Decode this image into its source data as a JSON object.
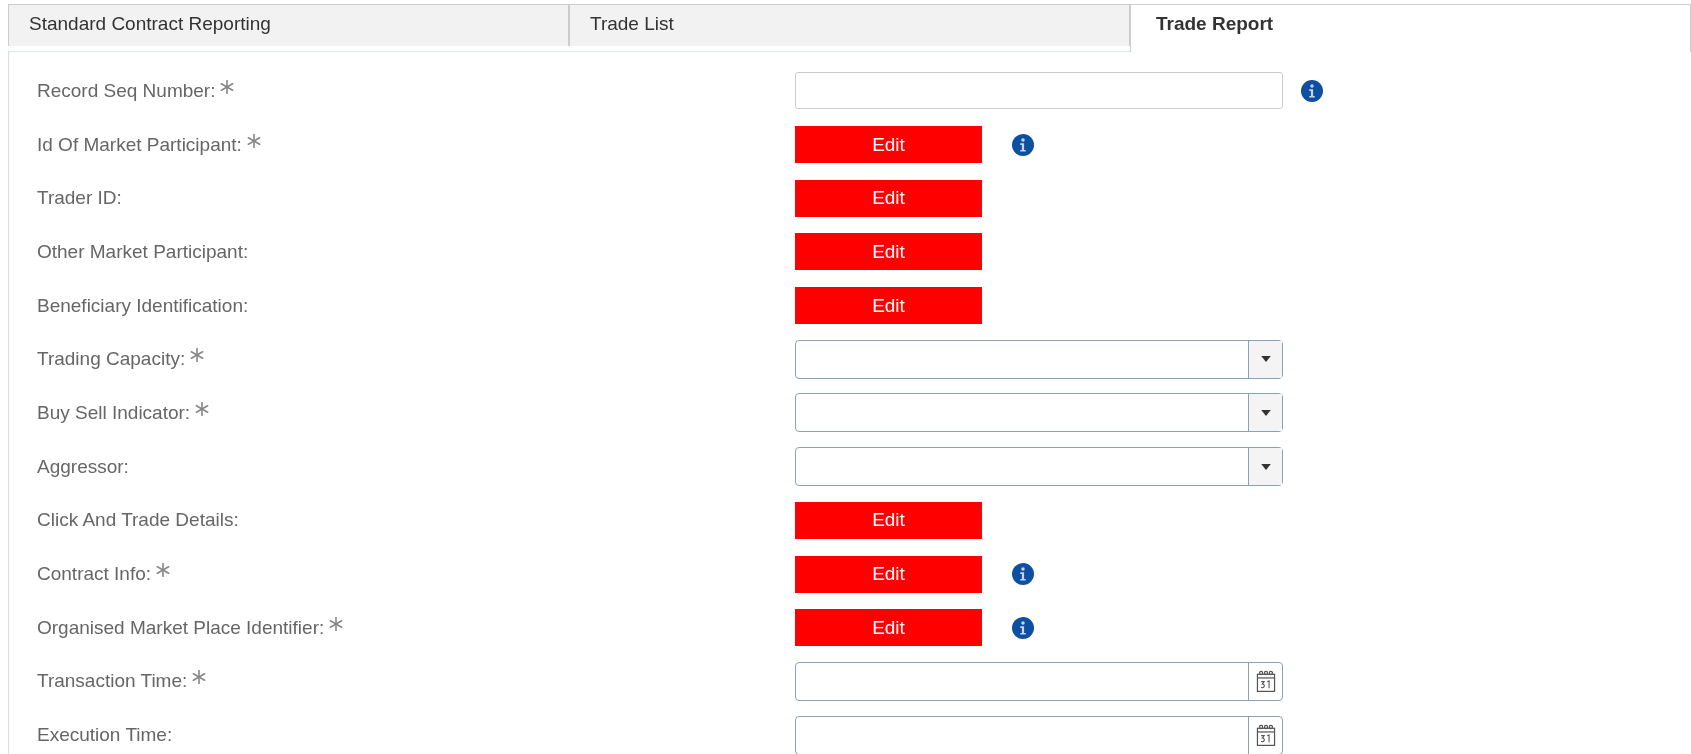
{
  "tabs": [
    {
      "label": "Standard Contract Reporting",
      "selected": false
    },
    {
      "label": "Trade List",
      "selected": false
    },
    {
      "label": "Trade Report",
      "selected": true
    }
  ],
  "form": {
    "rows": [
      {
        "label": "Record Seq Number:",
        "required": true,
        "kind": "text",
        "info": true
      },
      {
        "label": "Id Of Market Participant:",
        "required": true,
        "kind": "edit",
        "button": "Edit",
        "info": true
      },
      {
        "label": "Trader ID:",
        "required": false,
        "kind": "edit",
        "button": "Edit",
        "info": false
      },
      {
        "label": "Other Market Participant:",
        "required": false,
        "kind": "edit",
        "button": "Edit",
        "info": false
      },
      {
        "label": "Beneficiary Identification:",
        "required": false,
        "kind": "edit",
        "button": "Edit",
        "info": false
      },
      {
        "label": "Trading Capacity:",
        "required": true,
        "kind": "select",
        "info": false
      },
      {
        "label": "Buy Sell Indicator:",
        "required": true,
        "kind": "select",
        "info": false
      },
      {
        "label": "Aggressor:",
        "required": false,
        "kind": "select",
        "info": false
      },
      {
        "label": "Click And Trade Details:",
        "required": false,
        "kind": "edit",
        "button": "Edit",
        "info": false
      },
      {
        "label": "Contract Info:",
        "required": true,
        "kind": "edit",
        "button": "Edit",
        "info": true
      },
      {
        "label": "Organised Market Place Identifier:",
        "required": true,
        "kind": "edit",
        "button": "Edit",
        "info": true
      },
      {
        "label": "Transaction Time:",
        "required": true,
        "kind": "date",
        "info": false
      },
      {
        "label": "Execution Time:",
        "required": false,
        "kind": "date",
        "info": false
      }
    ]
  }
}
